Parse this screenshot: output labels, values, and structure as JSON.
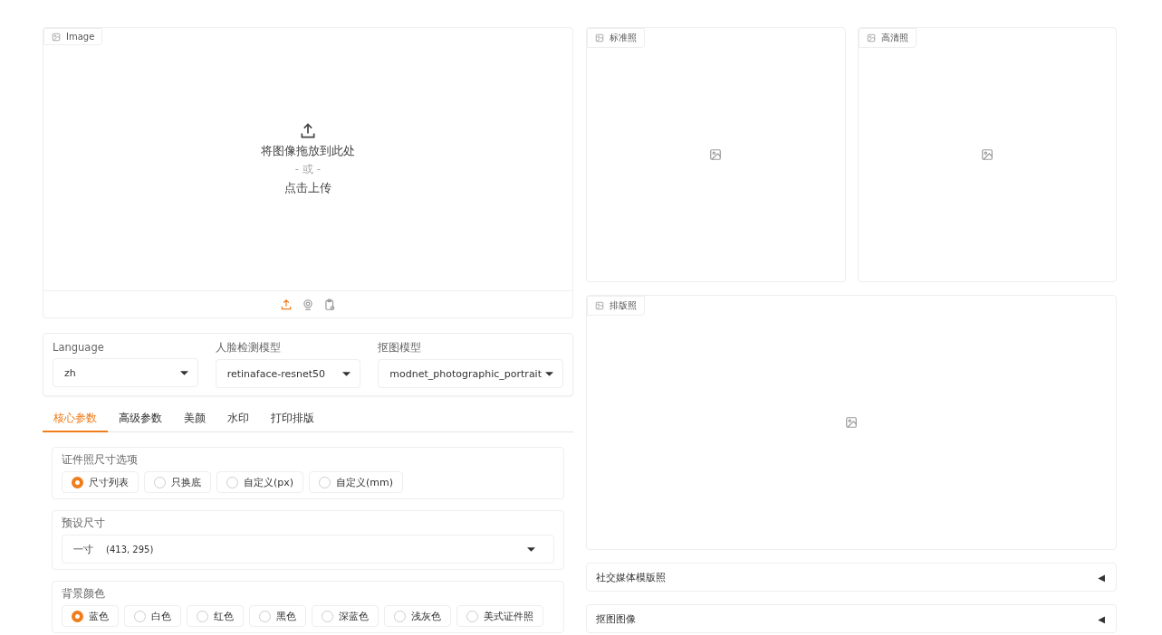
{
  "upload": {
    "label": "Image",
    "drop_text": "将图像拖放到此处",
    "or_text": "- 或 -",
    "click_text": "点击上传",
    "sources": [
      {
        "kind": "upload",
        "selected": true
      },
      {
        "kind": "webcam",
        "selected": false
      },
      {
        "kind": "clipboard",
        "selected": false
      }
    ]
  },
  "models": [
    {
      "label": "Language",
      "value": "zh"
    },
    {
      "label": "人脸检测模型",
      "value": "retinaface-resnet50"
    },
    {
      "label": "抠图模型",
      "value": "modnet_photographic_portrait"
    }
  ],
  "tabs": [
    {
      "label": "核心参数",
      "selected": true
    },
    {
      "label": "高级参数",
      "selected": false
    },
    {
      "label": "美颜",
      "selected": false
    },
    {
      "label": "水印",
      "selected": false
    },
    {
      "label": "打印排版",
      "selected": false
    }
  ],
  "size_option": {
    "label": "证件照尺寸选项",
    "options": [
      {
        "label": "尺寸列表",
        "selected": true
      },
      {
        "label": "只换底",
        "selected": false
      },
      {
        "label": "自定义(px)",
        "selected": false
      },
      {
        "label": "自定义(mm)",
        "selected": false
      }
    ]
  },
  "preset_size": {
    "label": "预设尺寸",
    "value": "一寸",
    "dims": "(413, 295)"
  },
  "background_color": {
    "label": "背景颜色",
    "options": [
      {
        "label": "蓝色",
        "selected": true
      },
      {
        "label": "白色",
        "selected": false
      },
      {
        "label": "红色",
        "selected": false
      },
      {
        "label": "黑色",
        "selected": false
      },
      {
        "label": "深蓝色",
        "selected": false
      },
      {
        "label": "浅灰色",
        "selected": false
      },
      {
        "label": "美式证件照",
        "selected": false
      }
    ]
  },
  "outputs": [
    {
      "label": "标准照"
    },
    {
      "label": "高清照"
    }
  ],
  "layout_output": {
    "label": "排版照"
  },
  "accordions": [
    {
      "label": "社交媒体模版照",
      "icon": "◀"
    },
    {
      "label": "抠图图像",
      "icon": "◀"
    }
  ]
}
